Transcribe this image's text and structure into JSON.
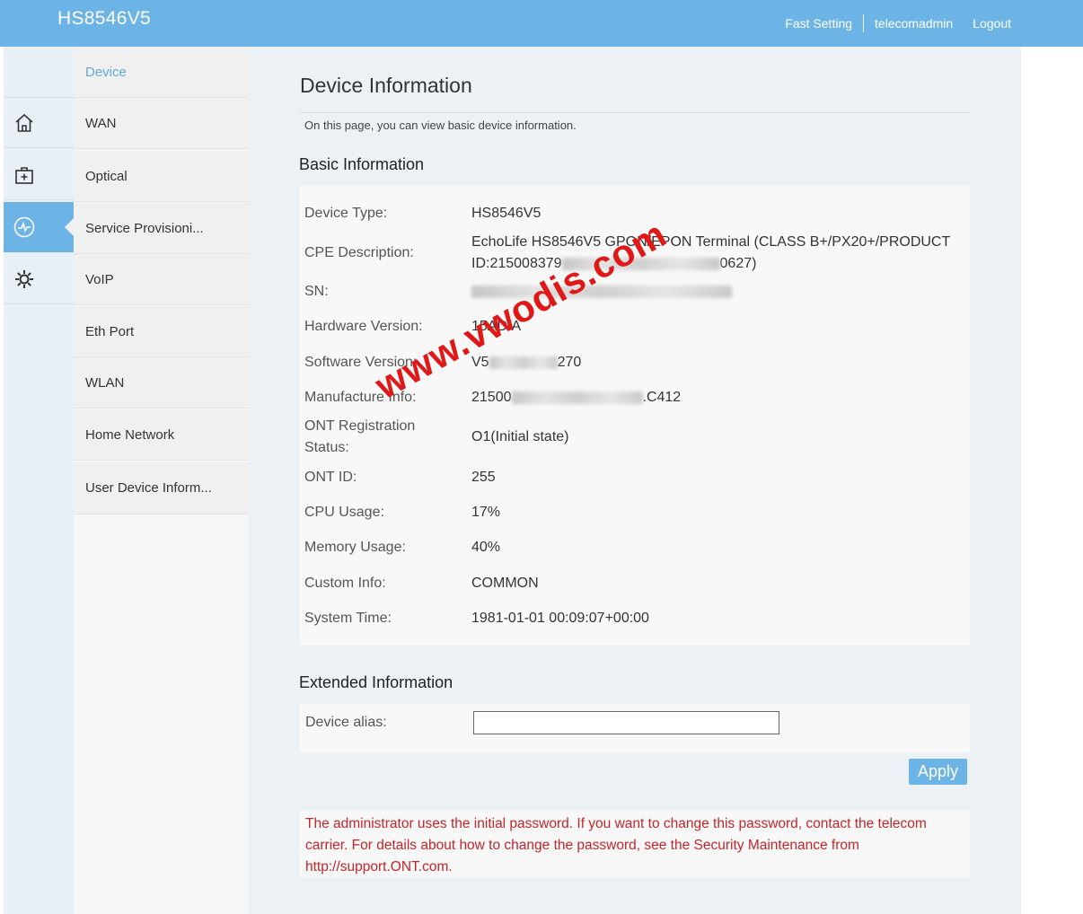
{
  "header": {
    "brand": "HS8546V5",
    "links": [
      "Fast Setting",
      "telecomadmin",
      "Logout"
    ]
  },
  "nav": {
    "icons": [
      "home-icon",
      "medical-kit-icon",
      "monitor-pulse-icon",
      "gear-icon"
    ],
    "active_icon": "monitor-pulse-icon",
    "submenu": [
      "Device",
      "WAN",
      "Optical",
      "Service Provisioni...",
      "VoIP",
      "Eth Port",
      "WLAN",
      "Home Network",
      "User Device Inform..."
    ]
  },
  "page": {
    "title": "Device Information",
    "description": "On this page, you can view basic device information."
  },
  "basic": {
    "title": "Basic Information",
    "rows": [
      {
        "label": "Device Type:",
        "value": "HS8546V5"
      },
      {
        "label": "CPE Description:",
        "value_line1": "EchoLife HS8546V5 GPON/EPON Terminal (CLASS B+/PX20+/PRODUCT",
        "value_line2_start": "ID:215008379",
        "value_line2_end": "0627)"
      },
      {
        "label": "SN:",
        "value": ""
      },
      {
        "label": "Hardware Version:",
        "value": "15AD.A"
      },
      {
        "label": "Software Version:",
        "value_start": "V5",
        "value_end": "270"
      },
      {
        "label": "Manufacture Info:",
        "value_start": "21500",
        "value_end": ".C412"
      },
      {
        "label_line1": "ONT Registration",
        "label_line2": "Status:",
        "value": "O1(Initial state)"
      },
      {
        "label": "ONT ID:",
        "value": "255"
      },
      {
        "label": "CPU Usage:",
        "value": "17%"
      },
      {
        "label": "Memory Usage:",
        "value": "40%"
      },
      {
        "label": "Custom Info:",
        "value": "COMMON"
      },
      {
        "label": "System Time:",
        "value": "1981-01-01 00:09:07+00:00"
      }
    ]
  },
  "extended": {
    "title": "Extended Information",
    "alias_label": "Device alias:",
    "alias_value": "",
    "apply_label": "Apply"
  },
  "warning": "The administrator uses the initial password. If you want to change this password, contact the telecom carrier. For details about how to change the password, see the Security Maintenance from http://support.ONT.com.",
  "watermark": "www.vwodis.com",
  "colors": {
    "accent": "#6cb3e6",
    "warning": "#c0262b",
    "watermark": "#e01818"
  }
}
